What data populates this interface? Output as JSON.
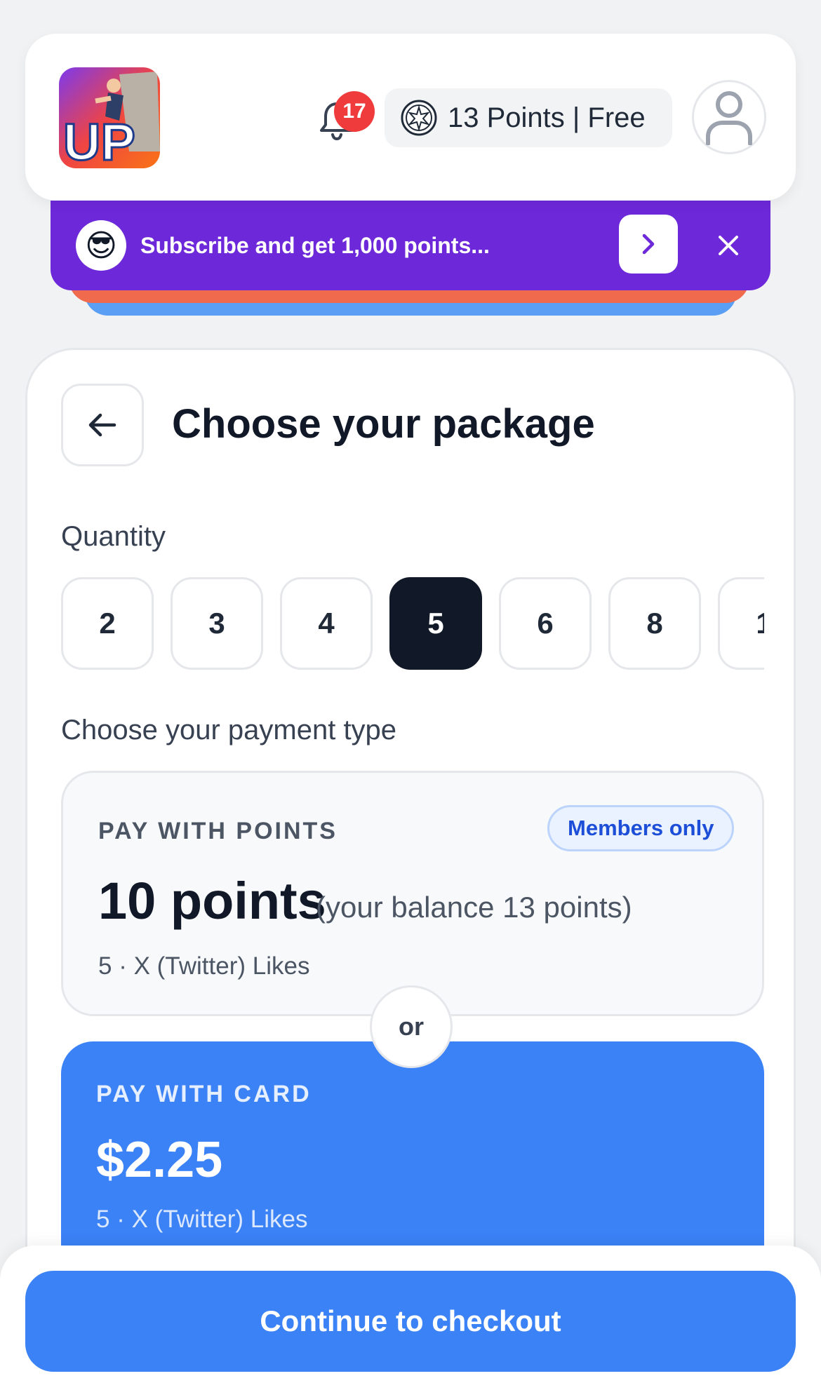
{
  "header": {
    "logo_text": "UP",
    "notification_count": "17",
    "points_pill": "13 Points | Free"
  },
  "promo": {
    "emoji": "😎",
    "message": "Subscribe and get 1,000 points..."
  },
  "package": {
    "title": "Choose your package",
    "quantity_label": "Quantity",
    "quantities": [
      "2",
      "3",
      "4",
      "5",
      "6",
      "8",
      "1"
    ],
    "selected_quantity": "5",
    "payment_label": "Choose your payment type"
  },
  "pay_points": {
    "kicker": "PAY WITH POINTS",
    "badge": "Members only",
    "amount": "10 points",
    "balance": "(your balance 13 points)",
    "description": "5 · X (Twitter) Likes"
  },
  "divider": "or",
  "pay_card": {
    "kicker": "PAY WITH CARD",
    "amount": "$2.25",
    "description": "5 · X (Twitter) Likes"
  },
  "checkout": {
    "label": "Continue to checkout"
  },
  "colors": {
    "primary": "#3b82f6",
    "promo": "#6d28d9",
    "badge_red": "#ef3b3b",
    "selected": "#111827"
  },
  "icons": {
    "bell": "bell-icon",
    "coin": "points-coin-icon",
    "avatar": "user-icon",
    "back": "arrow-left-icon",
    "promo_go": "chevron-right-icon",
    "promo_close": "close-icon"
  }
}
